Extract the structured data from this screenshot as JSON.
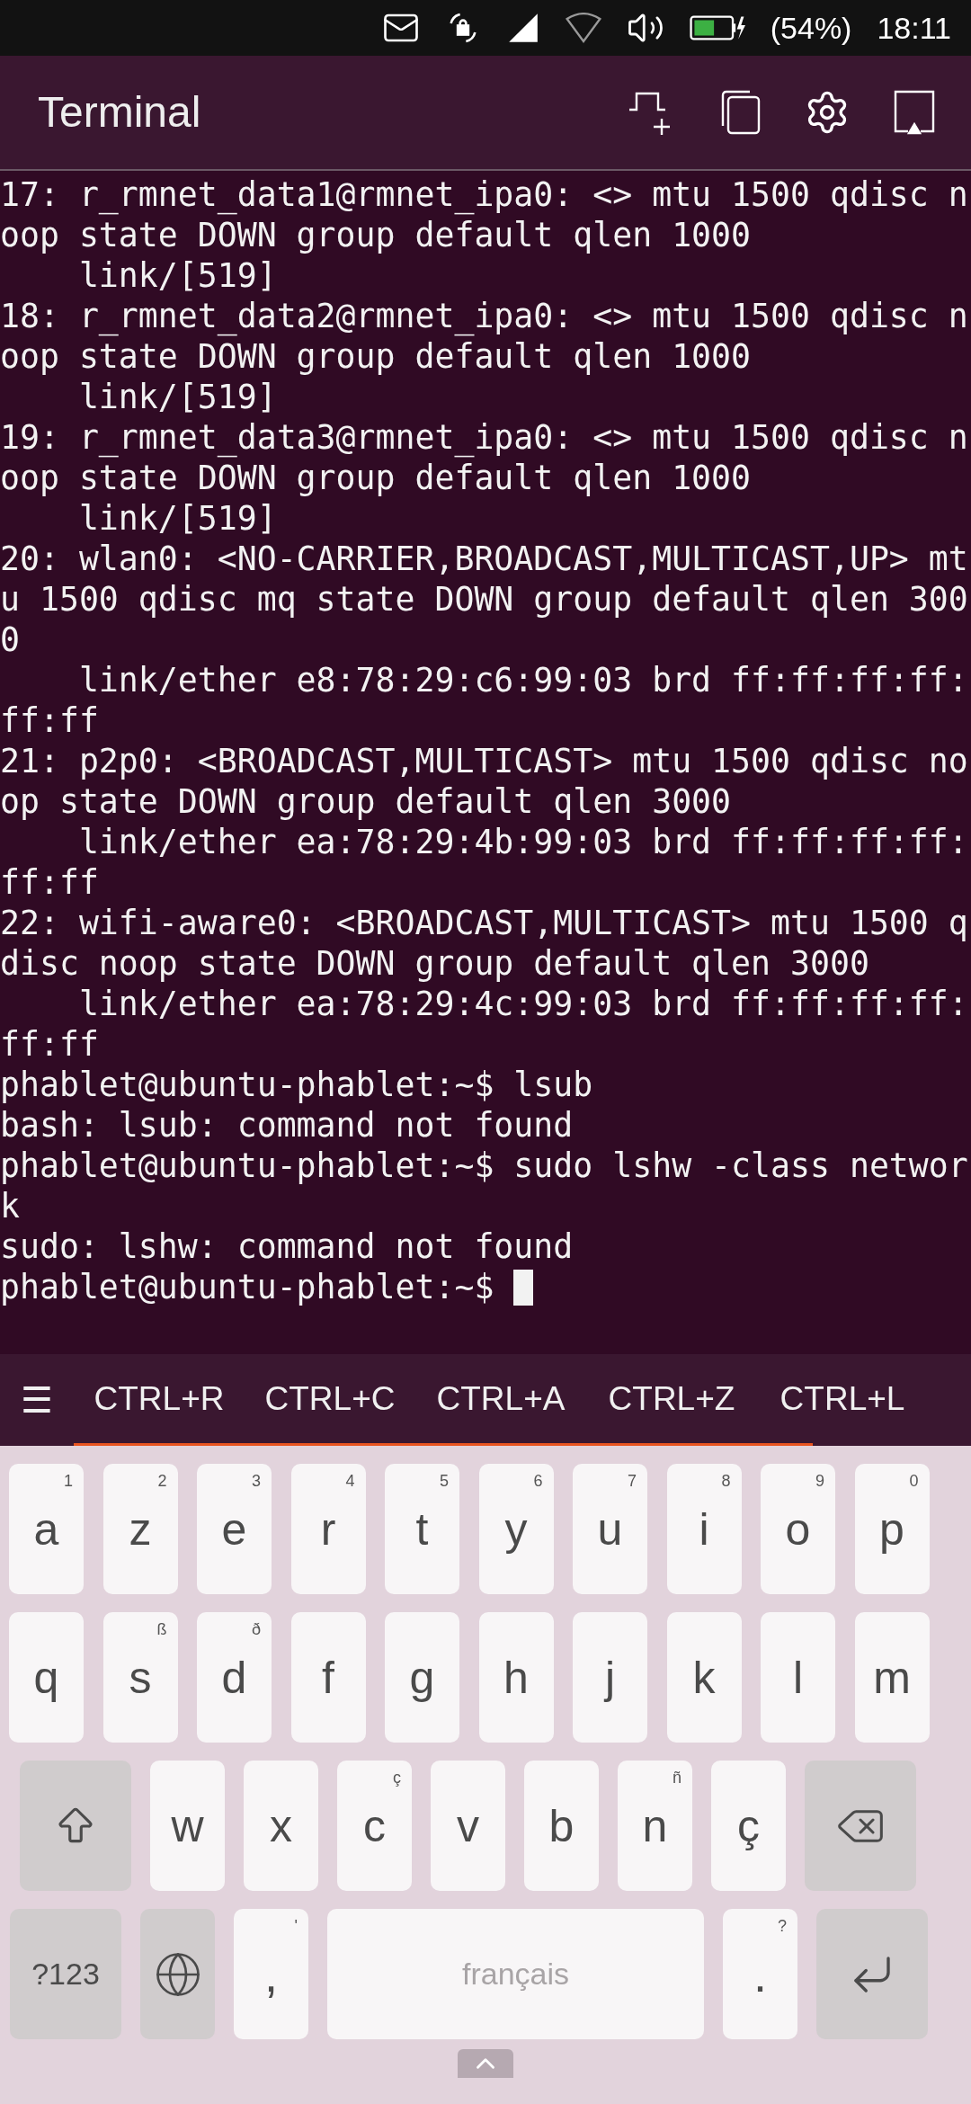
{
  "status_bar": {
    "battery": "(54%)",
    "time": "18:11"
  },
  "header": {
    "title": "Terminal"
  },
  "terminal": {
    "lines": [
      "17: r_rmnet_data1@rmnet_ipa0: <> mtu 1500 qdisc n",
      "oop state DOWN group default qlen 1000",
      "    link/[519]",
      "18: r_rmnet_data2@rmnet_ipa0: <> mtu 1500 qdisc n",
      "oop state DOWN group default qlen 1000",
      "    link/[519]",
      "19: r_rmnet_data3@rmnet_ipa0: <> mtu 1500 qdisc n",
      "oop state DOWN group default qlen 1000",
      "    link/[519]",
      "20: wlan0: <NO-CARRIER,BROADCAST,MULTICAST,UP> mt",
      "u 1500 qdisc mq state DOWN group default qlen 300",
      "0",
      "    link/ether e8:78:29:c6:99:03 brd ff:ff:ff:ff:",
      "ff:ff",
      "21: p2p0: <BROADCAST,MULTICAST> mtu 1500 qdisc no",
      "op state DOWN group default qlen 3000",
      "    link/ether ea:78:29:4b:99:03 brd ff:ff:ff:ff:",
      "ff:ff",
      "22: wifi-aware0: <BROADCAST,MULTICAST> mtu 1500 q",
      "disc noop state DOWN group default qlen 3000",
      "    link/ether ea:78:29:4c:99:03 brd ff:ff:ff:ff:",
      "ff:ff",
      "phablet@ubuntu-phablet:~$ lsub",
      "bash: lsub: command not found",
      "phablet@ubuntu-phablet:~$ sudo lshw -class networ",
      "k",
      "sudo: lshw: command not found"
    ],
    "prompt": "phablet@ubuntu-phablet:~$ ",
    "cursor": true
  },
  "shortcuts": {
    "menu": "☰",
    "items": [
      "CTRL+R",
      "CTRL+C",
      "CTRL+A",
      "CTRL+Z",
      "CTRL+L"
    ]
  },
  "keyboard": {
    "rows": [
      [
        {
          "kind": "letter",
          "label": "a",
          "hint": "1"
        },
        {
          "kind": "letter",
          "label": "z",
          "hint": "2"
        },
        {
          "kind": "letter",
          "label": "e",
          "hint": "3"
        },
        {
          "kind": "letter",
          "label": "r",
          "hint": "4"
        },
        {
          "kind": "letter",
          "label": "t",
          "hint": "5"
        },
        {
          "kind": "letter",
          "label": "y",
          "hint": "6"
        },
        {
          "kind": "letter",
          "label": "u",
          "hint": "7"
        },
        {
          "kind": "letter",
          "label": "i",
          "hint": "8"
        },
        {
          "kind": "letter",
          "label": "o",
          "hint": "9"
        },
        {
          "kind": "letter",
          "label": "p",
          "hint": "0"
        }
      ],
      [
        {
          "kind": "letter",
          "label": "q"
        },
        {
          "kind": "letter",
          "label": "s",
          "hint": "ß"
        },
        {
          "kind": "letter",
          "label": "d",
          "hint": "ð"
        },
        {
          "kind": "letter",
          "label": "f"
        },
        {
          "kind": "letter",
          "label": "g"
        },
        {
          "kind": "letter",
          "label": "h"
        },
        {
          "kind": "letter",
          "label": "j"
        },
        {
          "kind": "letter",
          "label": "k"
        },
        {
          "kind": "letter",
          "label": "l"
        },
        {
          "kind": "letter",
          "label": "m"
        }
      ],
      [
        {
          "kind": "shift"
        },
        {
          "kind": "letter",
          "label": "w"
        },
        {
          "kind": "letter",
          "label": "x"
        },
        {
          "kind": "letter",
          "label": "c",
          "hint": "ç"
        },
        {
          "kind": "letter",
          "label": "v"
        },
        {
          "kind": "letter",
          "label": "b"
        },
        {
          "kind": "letter",
          "label": "n",
          "hint": "ñ"
        },
        {
          "kind": "letter",
          "label": "ç"
        },
        {
          "kind": "backspace"
        }
      ]
    ],
    "bottom_row": [
      {
        "kind": "symbols",
        "label": "?123"
      },
      {
        "kind": "globe"
      },
      {
        "kind": "letter",
        "label": ",",
        "hint": "'"
      },
      {
        "kind": "space",
        "label": "français"
      },
      {
        "kind": "letter",
        "label": ".",
        "hint": "?"
      },
      {
        "kind": "enter"
      }
    ]
  }
}
